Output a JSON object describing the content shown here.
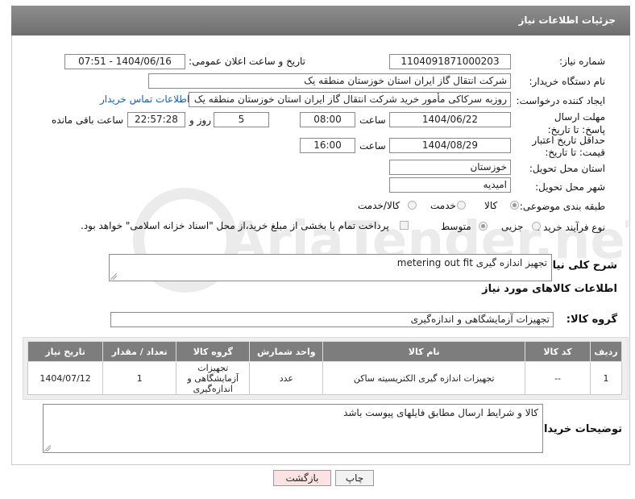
{
  "header": {
    "title": "جزئیات اطلاعات نیاز"
  },
  "form": {
    "need_number_label": "شماره نیاز:",
    "need_number": "1104091871000203",
    "announce_label": "تاریخ و ساعت اعلان عمومی:",
    "announce_value": "1404/06/16 - 07:51",
    "buyer_org_label": "نام دستگاه خریدار:",
    "buyer_org": "شرکت انتقال گاز ایران  استان خوزستان منطقه یک",
    "requester_label": "ایجاد کننده درخواست:",
    "requester": "روزبه سرکاکی مأمور خرید شرکت انتقال گاز ایران  استان خوزستان منطقه یک",
    "buyer_contact_link": "اطلاعات تماس خریدار",
    "reply_deadline_label": "مهلت ارسال پاسخ: تا تاریخ:",
    "reply_date": "1404/06/22",
    "time_label": "ساعت",
    "reply_time": "08:00",
    "days_value": "5",
    "days_label": "روز و",
    "remaining_time": "22:57:28",
    "remaining_label": "ساعت باقی مانده",
    "price_validity_label": "حداقل تاریخ اعتبار قیمت: تا تاریخ:",
    "price_date": "1404/08/29",
    "price_time": "16:00",
    "province_label": "استان محل تحویل:",
    "province": "خوزستان",
    "city_label": "شهر محل تحویل:",
    "city": "امیدیه",
    "category_label": "طبقه بندی موضوعی:",
    "category_options": [
      "کالا",
      "خدمت",
      "کالا/خدمت"
    ],
    "category_selected": "کالا",
    "process_label": "نوع فرآیند خرید :",
    "process_options": [
      "جزیی",
      "متوسط"
    ],
    "process_selected": "متوسط",
    "payment_note": "پرداخت تمام یا بخشی از مبلغ خرید،از محل \"اسناد خزانه اسلامی\" خواهد بود.",
    "summary_label": "شرح کلی نیاز:",
    "summary": "تجهیز اندازه گیری metering  out fit",
    "goods_info_title": "اطلاعات کالاهای مورد نیاز",
    "goods_group_label": "گروه کالا:",
    "goods_group": "تجهیزات آزمایشگاهی و اندازه‌گیری"
  },
  "table": {
    "columns": [
      "ردیف",
      "کد کالا",
      "نام کالا",
      "واحد شمارش",
      "گروه کالا",
      "تعداد / مقدار",
      "تاریخ نیاز"
    ],
    "rows": [
      [
        "1",
        "--",
        "تجهیزات اندازه گیری الکتریسیته ساکن",
        "عدد",
        "تجهیزات آزمایشگاهی و اندازه‌گیری",
        "1",
        "1404/07/12"
      ]
    ]
  },
  "notes": {
    "label": "توضیحات خریدار:",
    "value": "کالا و شرایط ارسال مطابق فایلهای پیوست باشد"
  },
  "buttons": {
    "print": "چاپ",
    "back": "بازگشت"
  },
  "watermark": {
    "text": "AriaTender.neT"
  },
  "colors": {
    "header_bg": "#7d7d7d",
    "link": "#1a5ea8",
    "back_button_bg": "#fbe3e3"
  }
}
